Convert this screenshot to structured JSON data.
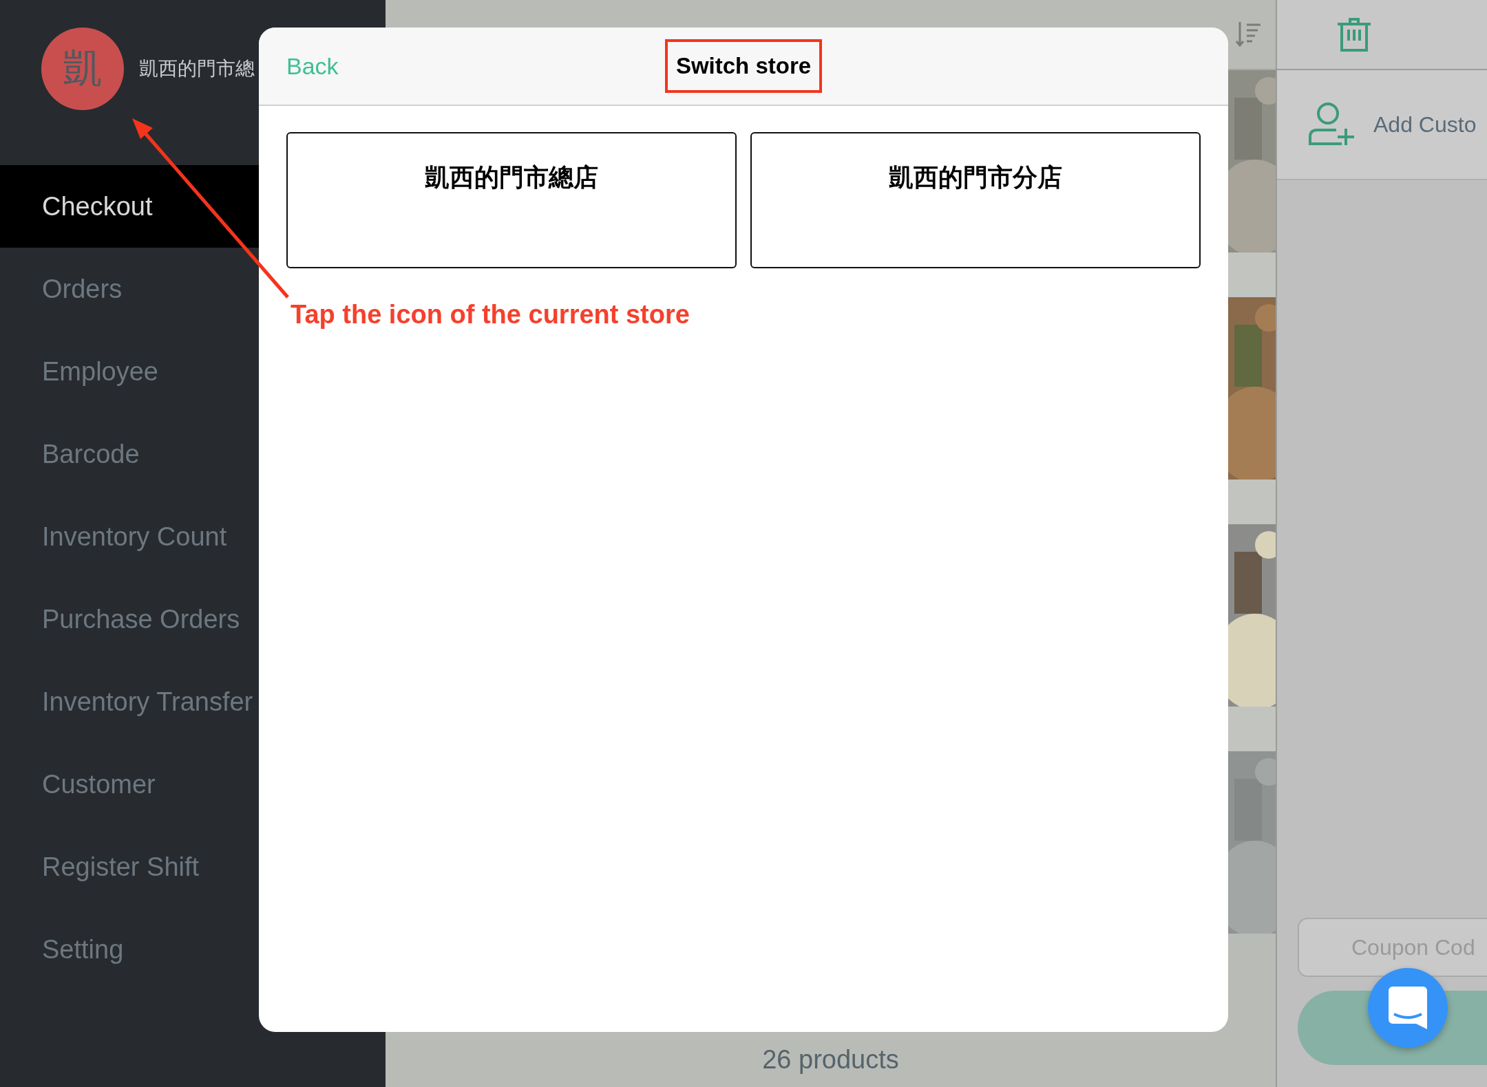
{
  "sidebar": {
    "store_initial": "凱",
    "store_name": "凱西的門市總",
    "items": [
      {
        "label": "Checkout",
        "selected": true
      },
      {
        "label": "Orders",
        "selected": false
      },
      {
        "label": "Employee",
        "selected": false
      },
      {
        "label": "Barcode",
        "selected": false
      },
      {
        "label": "Inventory Count",
        "selected": false
      },
      {
        "label": "Purchase Orders",
        "selected": false
      },
      {
        "label": "Inventory Transfer",
        "selected": false
      },
      {
        "label": "Customer",
        "selected": false
      },
      {
        "label": "Register Shift",
        "selected": false
      },
      {
        "label": "Setting",
        "selected": false
      }
    ]
  },
  "products": {
    "count": "26 products"
  },
  "cart": {
    "add_customer": "Add Custo",
    "coupon": {
      "placeholder": "Coupon Cod"
    }
  },
  "dialog": {
    "back": "Back",
    "title": "Switch store",
    "stores": [
      "凱西的門市總店",
      "凱西的門市分店"
    ]
  },
  "annotation": {
    "text": "Tap the icon of the current store"
  }
}
